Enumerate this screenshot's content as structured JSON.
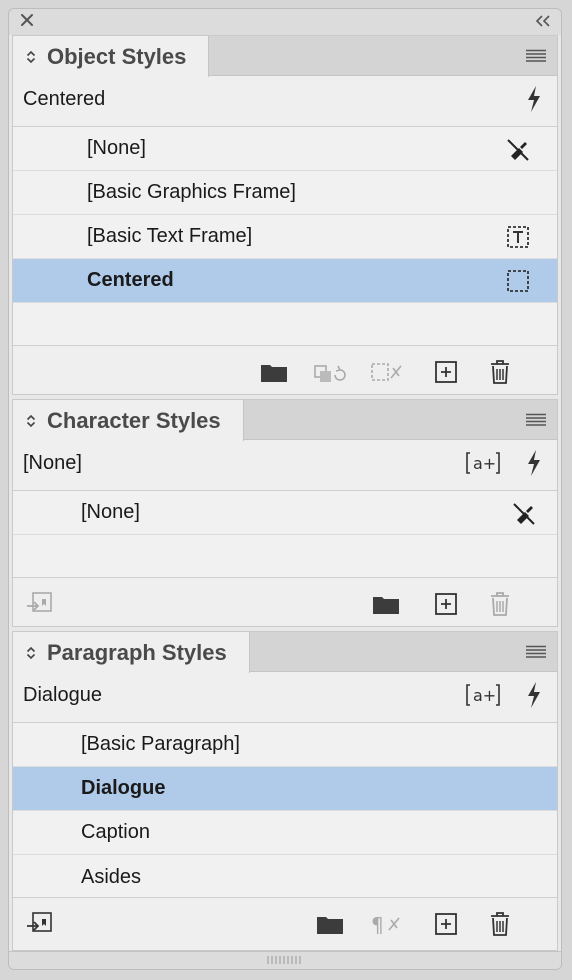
{
  "window": {
    "close_icon": "close-x-icon",
    "collapse_icon": "double-chevron-left-icon"
  },
  "object_styles": {
    "tab_title": "Object Styles",
    "current_style": "Centered",
    "items": [
      {
        "label": "[None]",
        "icon": "clear-overrides-brush-icon",
        "selected": false
      },
      {
        "label": "[Basic Graphics Frame]",
        "icon": "",
        "selected": false
      },
      {
        "label": "[Basic Text Frame]",
        "icon": "text-frame-icon",
        "selected": false
      },
      {
        "label": "Centered",
        "icon": "frame-icon",
        "selected": true
      }
    ]
  },
  "character_styles": {
    "tab_title": "Character Styles",
    "current_style": "[None]",
    "items": [
      {
        "label": "[None]",
        "icon": "clear-overrides-brush-icon",
        "selected": false
      }
    ]
  },
  "paragraph_styles": {
    "tab_title": "Paragraph Styles",
    "current_style": "Dialogue",
    "items": [
      {
        "label": "[Basic Paragraph]",
        "selected": false
      },
      {
        "label": "Dialogue",
        "selected": true
      },
      {
        "label": "Caption",
        "selected": false
      },
      {
        "label": "Asides",
        "selected": false
      }
    ]
  },
  "colors": {
    "selection": "#b0cbea",
    "panel_bg": "#efefef",
    "tab_bar": "#d4d4d4"
  }
}
